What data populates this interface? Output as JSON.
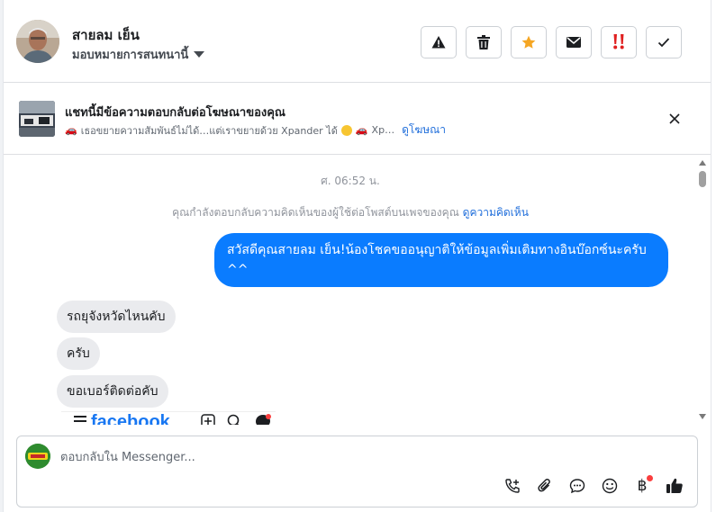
{
  "header": {
    "contact_name": "สายลม เย็น",
    "assign_label": "มอบหมายการสนทนานี้",
    "actions": [
      {
        "name": "report-button",
        "icon": "warning-icon"
      },
      {
        "name": "delete-button",
        "icon": "trash-icon"
      },
      {
        "name": "star-button",
        "icon": "star-icon"
      },
      {
        "name": "mark-unread-button",
        "icon": "envelope-icon"
      },
      {
        "name": "spam-button",
        "icon": "double-exclamation-icon"
      },
      {
        "name": "done-button",
        "icon": "check-icon"
      }
    ]
  },
  "ad_banner": {
    "title": "แชทนี้มีข้อความตอบกลับต่อโฆษณาของคุณ",
    "preview_part1": "เธอขยายความสัมพันธ์ไม่ได้…แต่เราขยายด้วย Xpander ได้",
    "preview_part2": "Xp…",
    "view_ad_link": "ดูโฆษณา"
  },
  "conversation": {
    "timestamp": "ศ. 06:52 น.",
    "notice_text": "คุณกำลังตอบกลับความคิดเห็นของผู้ใช้ต่อโพสต์บนเพจของคุณ",
    "notice_link": "ดูความคิดเห็น",
    "outgoing_message": "สวัสดีคุณสายลม เย็น!น้องโชคขออนุญาติให้ข้อมูลเพิ่มเติมทางอินบ๊อกซ์นะครับ ^^",
    "incoming_messages": [
      "รถยุจังหวัดไหนคับ",
      "ครับ",
      "ขอเบอร์ติดต่อคับ"
    ],
    "image_preview_text": "facebook"
  },
  "composer": {
    "placeholder": "ตอบกลับใน Messenger...",
    "baht_symbol": "฿",
    "tools": [
      "phone-plus-icon",
      "paperclip-icon",
      "chat-bubble-icon",
      "emoji-icon",
      "baht-icon",
      "thumbs-up-icon"
    ]
  },
  "colors": {
    "accent": "#0a7cff",
    "link": "#216fdb",
    "incoming_bubble": "#eaebee",
    "star": "#f5a623",
    "spam": "#e02020"
  }
}
